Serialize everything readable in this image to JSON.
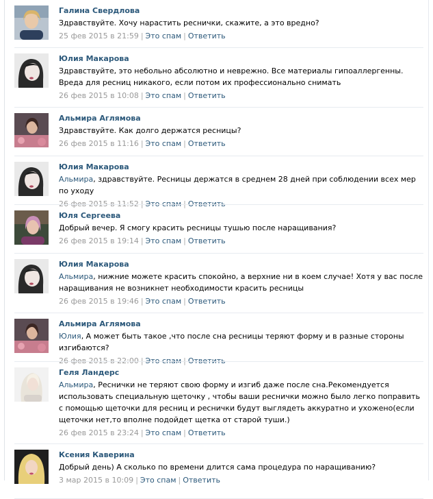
{
  "comments": [
    {
      "author": "Галина Свердлова",
      "mention": "",
      "text": "Здравствуйте. Хочу нарастить реснички, скажите, а это вредно?",
      "date": "25 фев 2015 в 21:59",
      "spam": "Это спам",
      "reply": "Ответить",
      "avatar": "avatar-galina"
    },
    {
      "author": "Юлия Макарова",
      "mention": "",
      "text": "Здравствуйте, это небольно абсолютно и неврежно. Все материалы гипоаллергенны. Вреда для ресниц никакого, если потом их профессионально снимать",
      "date": "26 фев 2015 в 10:08",
      "spam": "Это спам",
      "reply": "Ответить",
      "avatar": "avatar-yulia-m"
    },
    {
      "author": "Альмира Аглямова",
      "mention": "",
      "text": "Здравствуйте. Как долго держатся ресницы?",
      "date": "26 фев 2015 в 11:16",
      "spam": "Это спам",
      "reply": "Ответить",
      "avatar": "avatar-almira"
    },
    {
      "author": "Юлия Макарова",
      "mention": "Альмира",
      "text": ", здравствуйте. Ресницы держатся в среднем 28 дней при соблюдении всех мер по уходу",
      "date": "26 фев 2015 в 11:52",
      "spam": "Это спам",
      "reply": "Ответить",
      "avatar": "avatar-yulia-m"
    },
    {
      "author": "Юля Сергеева",
      "mention": "",
      "text": "Добрый вечер. Я смогу красить ресницы тушью после наращивания?",
      "date": "26 фев 2015 в 19:14",
      "spam": "Это спам",
      "reply": "Ответить",
      "avatar": "avatar-yulya-s"
    },
    {
      "author": "Юлия Макарова",
      "mention": "Альмира",
      "text": ", нижние можете красить спокойно, а верхние ни в коем случае! Хотя у вас после наращивания не возникнет необходимости красить ресницы",
      "date": "26 фев 2015 в 19:46",
      "spam": "Это спам",
      "reply": "Ответить",
      "avatar": "avatar-yulia-m"
    },
    {
      "author": "Альмира Аглямова",
      "mention": "Юлия",
      "text": ", А может быть такое ,что после сна ресницы теряют форму и в разные стороны изгибаются?",
      "date": "26 фев 2015 в 22:00",
      "spam": "Это спам",
      "reply": "Ответить",
      "avatar": "avatar-almira"
    },
    {
      "author": "Геля Ландерс",
      "mention": "Альмира",
      "text": ", Реснички не теряют свою форму и изгиб даже после сна.Рекомендуется использовать специальную щеточку , чтобы ваши реснички можно было легко поправить с помощью щеточки для ресниц и реснички будут выглядеть аккуратно и ухожено(если щеточки нет,то вполне подойдет щетка от старой туши.)",
      "date": "26 фев 2015 в 23:24",
      "spam": "Это спам",
      "reply": "Ответить",
      "avatar": "avatar-gelya"
    },
    {
      "author": "Ксения Каверина",
      "mention": "",
      "text": "Добрый день) А сколько по времени длится сама процедура по наращиванию?",
      "date": "3 мар 2015 в 10:09",
      "spam": "Это спам",
      "reply": "Ответить",
      "avatar": "avatar-kseniya"
    }
  ],
  "colors": {
    "link": "#2b587a",
    "meta": "#999999",
    "divider": "#e7ebf0"
  }
}
